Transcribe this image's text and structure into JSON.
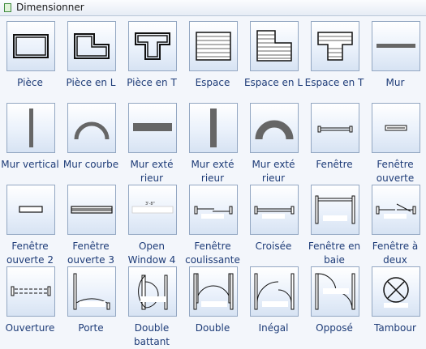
{
  "panel": {
    "title": "Dimensionner"
  },
  "items": [
    {
      "label": "Pièce",
      "icon": "room-icon"
    },
    {
      "label": "Pièce en L",
      "icon": "l-room-icon"
    },
    {
      "label": "Pièce en T",
      "icon": "t-room-icon"
    },
    {
      "label": "Espace",
      "icon": "space-icon"
    },
    {
      "label": "Espace en L",
      "icon": "l-space-icon"
    },
    {
      "label": "Espace en T",
      "icon": "t-space-icon"
    },
    {
      "label": "Mur",
      "icon": "wall-icon"
    },
    {
      "label": "Mur vertical",
      "icon": "vertical-wall-icon"
    },
    {
      "label": "Mur courbe",
      "icon": "curved-wall-icon"
    },
    {
      "label": "Mur exté rieur",
      "icon": "exterior-wall-icon"
    },
    {
      "label": "Mur exté rieur",
      "icon": "exterior-vertical-wall-icon"
    },
    {
      "label": "Mur exté rieur",
      "icon": "exterior-curved-wall-icon"
    },
    {
      "label": "Fenêtre",
      "icon": "window-icon"
    },
    {
      "label": "Fenêtre ouverte",
      "icon": "open-window-icon"
    },
    {
      "label": "Fenêtre ouverte 2",
      "icon": "open-window-2-icon"
    },
    {
      "label": "Fenêtre ouverte 3",
      "icon": "open-window-3-icon"
    },
    {
      "label": "Open Window 4",
      "icon": "open-window-4-icon"
    },
    {
      "label": "Fenêtre coulissante",
      "icon": "sliding-window-icon"
    },
    {
      "label": "Croisée",
      "icon": "casement-window-icon"
    },
    {
      "label": "Fenêtre en baie",
      "icon": "bay-window-icon"
    },
    {
      "label": "Fenêtre à deux",
      "icon": "double-window-icon"
    },
    {
      "label": "Ouverture",
      "icon": "opening-icon"
    },
    {
      "label": "Porte",
      "icon": "door-icon"
    },
    {
      "label": "Double battant",
      "icon": "double-swing-door-icon"
    },
    {
      "label": "Double",
      "icon": "double-door-icon"
    },
    {
      "label": "Inégal",
      "icon": "unequal-door-icon"
    },
    {
      "label": "Opposé",
      "icon": "opposite-door-icon"
    },
    {
      "label": "Tambour",
      "icon": "revolving-door-icon"
    }
  ],
  "glyph_texts": {
    "open_window_4": "3'-8\""
  }
}
